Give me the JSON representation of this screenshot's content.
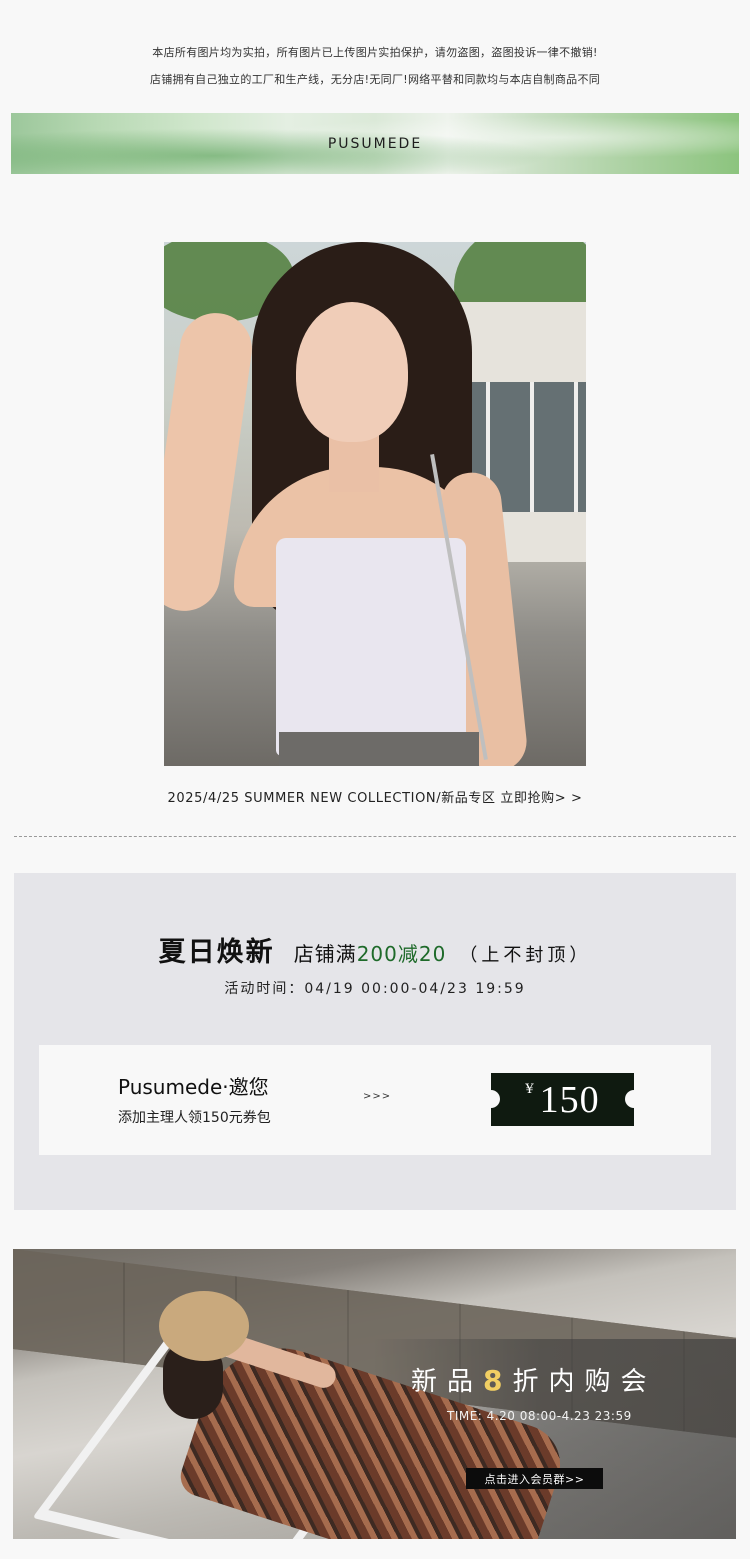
{
  "notice": {
    "line1": "本店所有图片均为实拍，所有图片已上传图片实拍保护，请勿盗图，盗图投诉一律不撤销!",
    "line2": "店铺拥有自己独立的工厂和生产线，无分店!无同厂!网络平替和同款均与本店自制商品不同"
  },
  "brand": {
    "name": "PUSUMEDE"
  },
  "collection": {
    "caption": "2025/4/25 SUMMER NEW COLLECTION/新品专区 立即抢购> >"
  },
  "promo": {
    "headline_main": "夏日焕新",
    "headline_store": "店铺满",
    "headline_deal": "200减20",
    "headline_note": "（上不封顶）",
    "time": "活动时间：04/19 00:00-04/23 19:59"
  },
  "invite": {
    "title": "Pusumede·邀您",
    "subtitle": "添加主理人领150元券包",
    "arrows": ">>>",
    "coupon_currency": "¥",
    "coupon_amount": "150"
  },
  "sale": {
    "title_pre": "新品",
    "title_num": "8",
    "title_post": "折内购会",
    "time": "TIME: 4.20 08:00-4.23 23:59",
    "button": "点击进入会员群>>"
  },
  "colors": {
    "deal_green": "#1e6a2a",
    "coupon_bg": "#0f1a10",
    "sale_accent": "#f2cf63",
    "promo_panel_bg": "#e5e5e9"
  }
}
